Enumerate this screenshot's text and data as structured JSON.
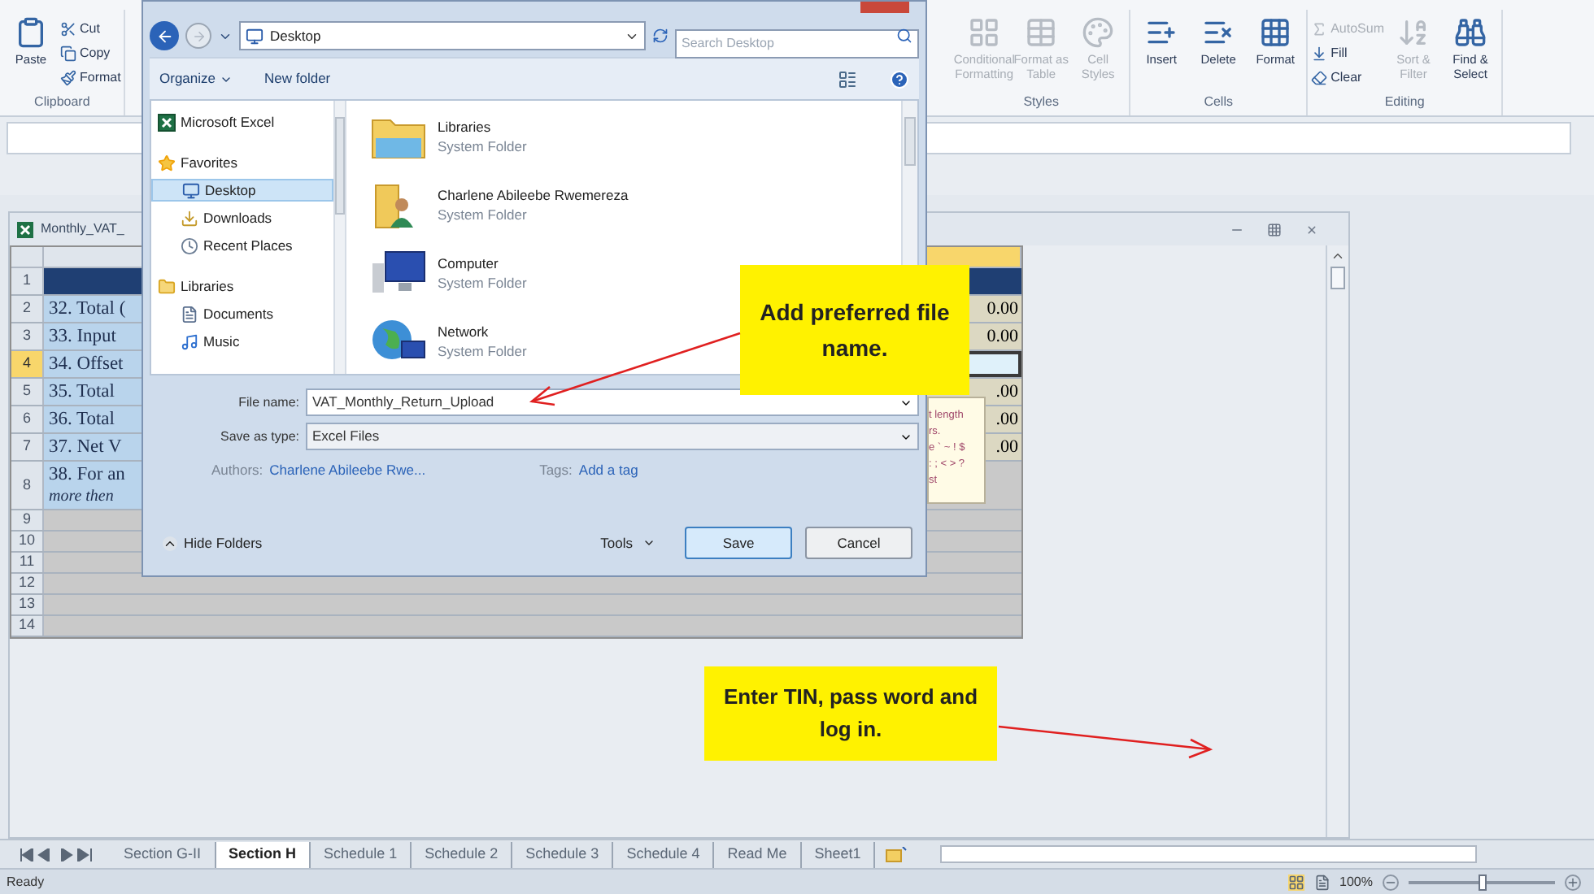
{
  "ribbon": {
    "groups": [
      {
        "name": "Clipboard",
        "buttons": [
          {
            "kind": "large",
            "label": "Paste",
            "disabled": false
          },
          {
            "kind": "small",
            "label": "Cut",
            "disabled": false
          },
          {
            "kind": "small",
            "label": "Copy",
            "disabled": false
          },
          {
            "kind": "small",
            "label": "Format",
            "disabled": false
          }
        ]
      },
      {
        "name": "Styles",
        "buttons": [
          {
            "kind": "large",
            "label": "Conditional Formatting",
            "disabled": true
          },
          {
            "kind": "large",
            "label": "Format as Table",
            "disabled": true
          },
          {
            "kind": "large",
            "label": "Cell Styles",
            "disabled": true
          }
        ]
      },
      {
        "name": "Cells",
        "buttons": [
          {
            "kind": "large",
            "label": "Insert",
            "disabled": false
          },
          {
            "kind": "large",
            "label": "Delete",
            "disabled": false
          },
          {
            "kind": "large",
            "label": "Format",
            "disabled": false
          }
        ]
      },
      {
        "name": "Editing",
        "buttons": [
          {
            "kind": "small",
            "label": "AutoSum",
            "disabled": true
          },
          {
            "kind": "small",
            "label": "Fill",
            "disabled": false
          },
          {
            "kind": "small",
            "label": "Clear",
            "disabled": false
          },
          {
            "kind": "large",
            "label": "Sort & Filter",
            "disabled": true
          },
          {
            "kind": "large",
            "label": "Find & Select",
            "disabled": false
          }
        ]
      }
    ]
  },
  "workbook": {
    "title": "Monthly_VAT_",
    "columns": [
      {
        "selected": false
      },
      {
        "selected": true
      }
    ],
    "rows": [
      {
        "num": "1",
        "kind": "header",
        "selected": false
      },
      {
        "num": "2",
        "text": "32. Total (",
        "value": "0.00",
        "kind": "data",
        "selected": false
      },
      {
        "num": "3",
        "text": "33. Input ",
        "value": "0.00",
        "kind": "data",
        "selected": false
      },
      {
        "num": "4",
        "text": "34. Offset",
        "kind": "data",
        "selected": true
      },
      {
        "num": "5",
        "text": "35. Total ",
        "value": ".00",
        "kind": "data",
        "selected": false
      },
      {
        "num": "6",
        "text": "36. Total ",
        "value": ".00",
        "kind": "data",
        "selected": false
      },
      {
        "num": "7",
        "text": "37. Net V",
        "value": ".00",
        "kind": "data",
        "selected": false
      },
      {
        "num": "8",
        "text": "38. For an",
        "note": "more then ",
        "kind": "tall",
        "selected": false
      },
      {
        "num": "9",
        "kind": "empty",
        "selected": false
      },
      {
        "num": "10",
        "kind": "empty",
        "selected": false
      },
      {
        "num": "11",
        "kind": "empty",
        "selected": false
      },
      {
        "num": "12",
        "kind": "empty",
        "selected": false
      },
      {
        "num": "13",
        "kind": "empty",
        "selected": false
      },
      {
        "num": "14",
        "kind": "empty",
        "selected": false
      }
    ],
    "tooltip_lines": [
      "t length",
      "rs.",
      "e ` ~ ! $",
      ": ; < > ?",
      "st"
    ]
  },
  "save_dialog": {
    "address": "Desktop",
    "search_placeholder": "Search Desktop",
    "toolbar": [
      "Organize",
      "New folder"
    ],
    "nav": [
      {
        "label": "Microsoft Excel",
        "kind": "excel",
        "selected": false
      },
      {
        "label": "Favorites",
        "kind": "star",
        "selected": false,
        "children": [
          {
            "label": "Desktop",
            "kind": "desktop",
            "selected": true
          },
          {
            "label": "Downloads",
            "kind": "downloads",
            "selected": false
          },
          {
            "label": "Recent Places",
            "kind": "recent",
            "selected": false
          }
        ]
      },
      {
        "label": "Libraries",
        "kind": "library",
        "selected": false,
        "children": [
          {
            "label": "Documents",
            "kind": "documents",
            "selected": false
          },
          {
            "label": "Music",
            "kind": "music",
            "selected": false
          }
        ]
      }
    ],
    "files": [
      {
        "name": "Libraries",
        "type": "System Folder",
        "kind": "library"
      },
      {
        "name": "Charlene Abileebe Rwemereza",
        "type": "System Folder",
        "kind": "user"
      },
      {
        "name": "Computer",
        "type": "System Folder",
        "kind": "computer"
      },
      {
        "name": "Network",
        "type": "System Folder",
        "kind": "network"
      }
    ],
    "file_name_label": "File name:",
    "file_name": "VAT_Monthly_Return_Upload",
    "save_type_label": "Save as type:",
    "save_type": "Excel Files",
    "authors_label": "Authors:",
    "authors": "Charlene Abileebe Rwe...",
    "tags_label": "Tags:",
    "tags": "Add a tag",
    "hide_folders": "Hide Folders",
    "tools": "Tools",
    "buttons": [
      "Save",
      "Cancel"
    ]
  },
  "callouts": [
    {
      "text": "Add preferred file name."
    },
    {
      "text": "Enter TIN, pass word and log in."
    }
  ],
  "sheet_tabs": [
    {
      "label": "Section G-II",
      "selected": false
    },
    {
      "label": "Section H",
      "selected": true
    },
    {
      "label": "Schedule 1",
      "selected": false
    },
    {
      "label": "Schedule 2",
      "selected": false
    },
    {
      "label": "Schedule 3",
      "selected": false
    },
    {
      "label": "Schedule 4",
      "selected": false
    },
    {
      "label": "Read Me",
      "selected": false
    },
    {
      "label": "Sheet1",
      "selected": false
    }
  ],
  "status_bar": {
    "status": "Ready",
    "zoom": "100%",
    "level": 0.5
  }
}
